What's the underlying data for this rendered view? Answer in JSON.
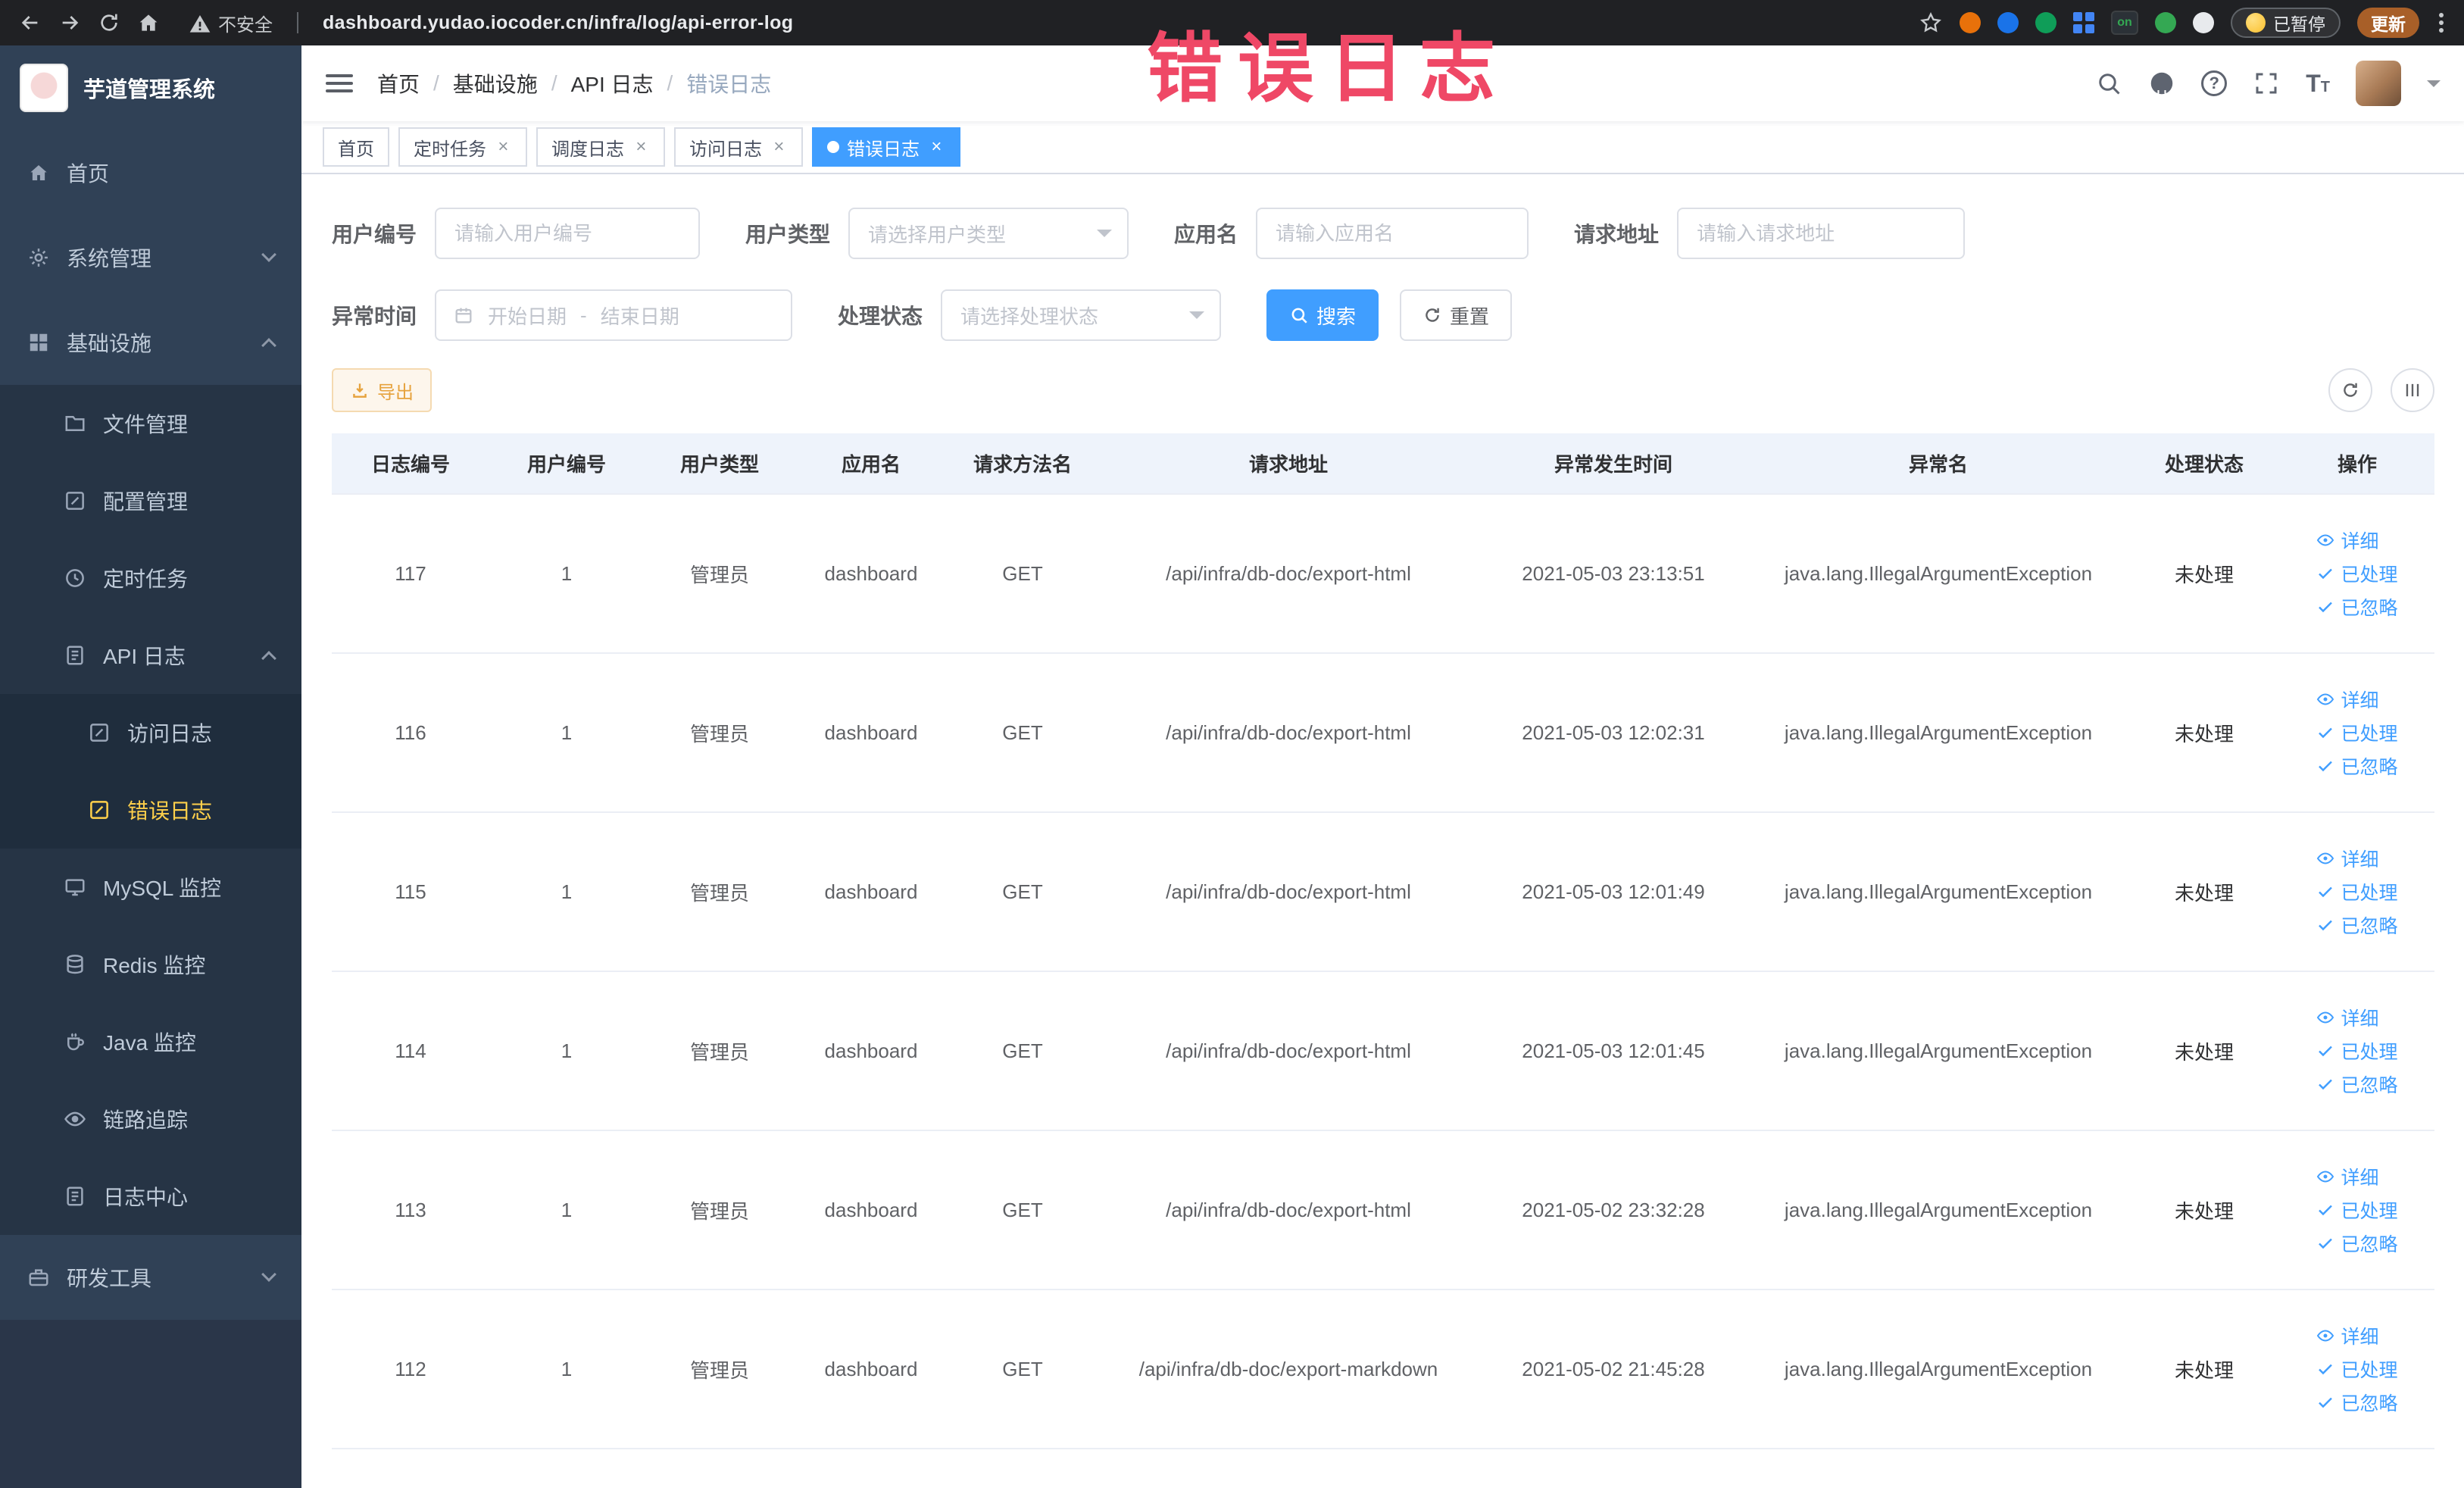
{
  "browser": {
    "security_label": "不安全",
    "url": "dashboard.yudao.iocoder.cn/infra/log/api-error-log",
    "paused_badge": "已暂停",
    "update_button": "更新",
    "extension_on_badge": "on"
  },
  "icons": {
    "search": "magnifier",
    "github": "octocat-circle",
    "help": "question-circle",
    "fullscreen": "corner-brackets",
    "font_size": "T",
    "detail": "eye",
    "done": "check",
    "export": "download-arrow",
    "refresh": "circular-arrow",
    "column_settings": "columns"
  },
  "sidebar": {
    "logo_title": "芋道管理系统",
    "items": {
      "home": "首页",
      "system": "系统管理",
      "infra": "基础设施",
      "file": "文件管理",
      "config": "配置管理",
      "job": "定时任务",
      "api_log": "API 日志",
      "access_log": "访问日志",
      "error_log": "错误日志",
      "mysql": "MySQL 监控",
      "redis": "Redis 监控",
      "java": "Java 监控",
      "trace": "链路追踪",
      "log_center": "日志中心",
      "dev_tools": "研发工具"
    }
  },
  "header": {
    "breadcrumb": [
      "首页",
      "基础设施",
      "API 日志",
      "错误日志"
    ],
    "separator": "/"
  },
  "annotation": "错误日志",
  "tabs": [
    {
      "label": "首页"
    },
    {
      "label": "定时任务"
    },
    {
      "label": "调度日志"
    },
    {
      "label": "访问日志"
    },
    {
      "label": "错误日志"
    }
  ],
  "filters": {
    "user_id_label": "用户编号",
    "user_id_placeholder": "请输入用户编号",
    "user_type_label": "用户类型",
    "user_type_placeholder": "请选择用户类型",
    "app_name_label": "应用名",
    "app_name_placeholder": "请输入应用名",
    "request_url_label": "请求地址",
    "request_url_placeholder": "请输入请求地址",
    "time_label": "异常时间",
    "time_start_placeholder": "开始日期",
    "time_separator": "-",
    "time_end_placeholder": "结束日期",
    "status_label": "处理状态",
    "status_placeholder": "请选择处理状态",
    "search_button": "搜索",
    "reset_button": "重置"
  },
  "toolbar": {
    "export_button": "导出"
  },
  "table": {
    "columns": [
      "日志编号",
      "用户编号",
      "用户类型",
      "应用名",
      "请求方法名",
      "请求地址",
      "异常发生时间",
      "异常名",
      "处理状态",
      "操作"
    ],
    "actions": {
      "detail": "详细",
      "processed": "已处理",
      "ignored": "已忽略"
    },
    "rows": [
      {
        "id": "117",
        "user_id": "1",
        "user_type": "管理员",
        "app": "dashboard",
        "method": "GET",
        "url": "/api/infra/db-doc/export-html",
        "time": "2021-05-03 23:13:51",
        "exception": "java.lang.IllegalArgumentException",
        "status": "未处理"
      },
      {
        "id": "116",
        "user_id": "1",
        "user_type": "管理员",
        "app": "dashboard",
        "method": "GET",
        "url": "/api/infra/db-doc/export-html",
        "time": "2021-05-03 12:02:31",
        "exception": "java.lang.IllegalArgumentException",
        "status": "未处理"
      },
      {
        "id": "115",
        "user_id": "1",
        "user_type": "管理员",
        "app": "dashboard",
        "method": "GET",
        "url": "/api/infra/db-doc/export-html",
        "time": "2021-05-03 12:01:49",
        "exception": "java.lang.IllegalArgumentException",
        "status": "未处理"
      },
      {
        "id": "114",
        "user_id": "1",
        "user_type": "管理员",
        "app": "dashboard",
        "method": "GET",
        "url": "/api/infra/db-doc/export-html",
        "time": "2021-05-03 12:01:45",
        "exception": "java.lang.IllegalArgumentException",
        "status": "未处理"
      },
      {
        "id": "113",
        "user_id": "1",
        "user_type": "管理员",
        "app": "dashboard",
        "method": "GET",
        "url": "/api/infra/db-doc/export-html",
        "time": "2021-05-02 23:32:28",
        "exception": "java.lang.IllegalArgumentException",
        "status": "未处理"
      },
      {
        "id": "112",
        "user_id": "1",
        "user_type": "管理员",
        "app": "dashboard",
        "method": "GET",
        "url": "/api/infra/db-doc/export-markdown",
        "time": "2021-05-02 21:45:28",
        "exception": "java.lang.IllegalArgumentException",
        "status": "未处理"
      }
    ]
  }
}
